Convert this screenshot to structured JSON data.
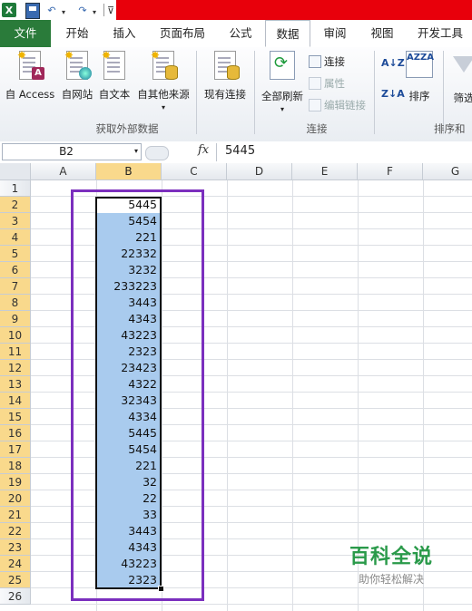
{
  "qat": {
    "app_icon": "X",
    "undo": "↶",
    "redo": "↷",
    "dropdown": "▾",
    "customize": "⊽"
  },
  "tabs": [
    {
      "label": "文件"
    },
    {
      "label": "开始"
    },
    {
      "label": "插入"
    },
    {
      "label": "页面布局"
    },
    {
      "label": "公式"
    },
    {
      "label": "数据"
    },
    {
      "label": "审阅"
    },
    {
      "label": "视图"
    },
    {
      "label": "开发工具"
    }
  ],
  "ribbon": {
    "get_external": {
      "buttons": [
        "自 Access",
        "自网站",
        "自文本",
        "自其他来源"
      ],
      "existing": "现有连接",
      "label": "获取外部数据",
      "access_badge": "A",
      "more_arrow": "▾"
    },
    "connections": {
      "refresh_all": "全部刷新",
      "refresh_arrow": "▾",
      "connect": "连接",
      "properties": "属性",
      "edit_links": "编辑链接",
      "label": "连接"
    },
    "sort_filter": {
      "sort_az": "A↓Z",
      "sort_za": "Z↓A",
      "sort_box": "AZZA",
      "sort": "排序",
      "filter": "筛选",
      "label": "排序和"
    }
  },
  "formula_bar": {
    "name_box": "B2",
    "fx": "fx",
    "value": "5445"
  },
  "columns": [
    "A",
    "B",
    "C",
    "D",
    "E",
    "F",
    "G"
  ],
  "rows": [
    "1",
    "2",
    "3",
    "4",
    "5",
    "6",
    "7",
    "8",
    "9",
    "10",
    "11",
    "12",
    "13",
    "14",
    "15",
    "16",
    "17",
    "18",
    "19",
    "20",
    "21",
    "22",
    "23",
    "24",
    "25",
    "26"
  ],
  "cells_B": [
    "5445",
    "5454",
    "221",
    "22332",
    "3232",
    "233223",
    "3443",
    "4343",
    "43223",
    "2323",
    "23423",
    "4322",
    "32343",
    "4334",
    "5445",
    "5454",
    "221",
    "32",
    "22",
    "33",
    "3443",
    "4343",
    "43223",
    "2323"
  ],
  "watermark": {
    "title": "百科全说",
    "subtitle": "助你轻松解决"
  },
  "colors": {
    "selection": "#a9cbee",
    "highlight_box": "#7b2fbe",
    "file_tab": "#2a7b3a",
    "title_bar": "#e8000b"
  }
}
